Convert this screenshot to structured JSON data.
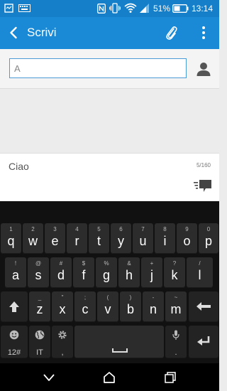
{
  "status_bar": {
    "battery": "51%",
    "time": "13:14",
    "icons": [
      "notification-icon",
      "keyboard-icon",
      "nfc-icon",
      "vibrate-icon",
      "wifi-icon",
      "signal-icon",
      "battery-icon"
    ]
  },
  "app_bar": {
    "title": "Scrivi",
    "icons": [
      "back-icon",
      "attach-icon",
      "more-icon"
    ]
  },
  "recipient": {
    "value": "A",
    "icon": "contact-icon"
  },
  "composer": {
    "message": "Ciao",
    "counter": "5/160",
    "icon": "send-icon"
  },
  "keyboard": {
    "row1": [
      {
        "main": "q",
        "sub": "1"
      },
      {
        "main": "w",
        "sub": "2"
      },
      {
        "main": "e",
        "sub": "3"
      },
      {
        "main": "r",
        "sub": "4"
      },
      {
        "main": "t",
        "sub": "5"
      },
      {
        "main": "y",
        "sub": "6"
      },
      {
        "main": "u",
        "sub": "7"
      },
      {
        "main": "i",
        "sub": "8"
      },
      {
        "main": "o",
        "sub": "9"
      },
      {
        "main": "p",
        "sub": "0"
      }
    ],
    "row2": [
      {
        "main": "a",
        "sub": "!"
      },
      {
        "main": "s",
        "sub": "@"
      },
      {
        "main": "d",
        "sub": "#"
      },
      {
        "main": "f",
        "sub": "$"
      },
      {
        "main": "g",
        "sub": "%"
      },
      {
        "main": "h",
        "sub": "&"
      },
      {
        "main": "j",
        "sub": "+"
      },
      {
        "main": "k",
        "sub": "?"
      },
      {
        "main": "l",
        "sub": "/"
      }
    ],
    "row3": [
      {
        "main": "z",
        "sub": "_"
      },
      {
        "main": "x",
        "sub": "\""
      },
      {
        "main": "c",
        "sub": ";"
      },
      {
        "main": "v",
        "sub": "("
      },
      {
        "main": "b",
        "sub": ")"
      },
      {
        "main": "n",
        "sub": "-"
      },
      {
        "main": "m",
        "sub": "~"
      }
    ],
    "symbols_label": "12#",
    "language_label": "IT",
    "settings_label": ",",
    "mic_label": ".",
    "colors": {
      "key": "#2c2c2c",
      "background": "#111111"
    }
  },
  "nav_bar": {
    "icons": [
      "back-nav-icon",
      "home-icon",
      "recents-icon"
    ]
  }
}
